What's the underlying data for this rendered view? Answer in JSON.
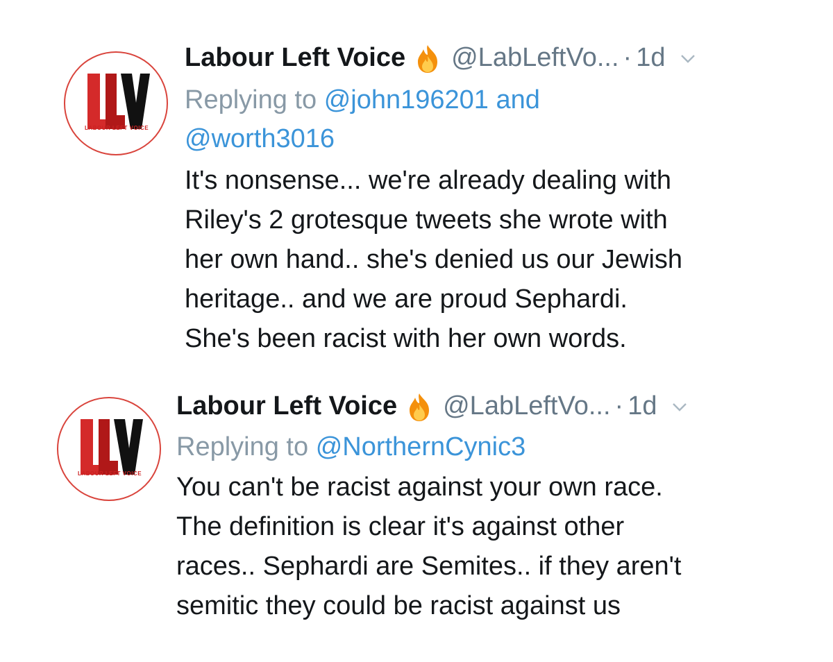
{
  "tweets": [
    {
      "author": "Labour Left Voice",
      "handle": "@LabLeftVo...",
      "separator": "·",
      "time": "1d",
      "reply_prefix": "Replying to",
      "reply_mentions": [
        "@john196201",
        "and",
        "@worth3016"
      ],
      "text": "It's nonsense... we're already dealing with\nRiley's 2 grotesque tweets she wrote with\nher own hand.. she's denied us our Jewish\nheritage.. and we are proud Sephardi.\nShe's been racist with her own words.",
      "avatar_logo_text": "LLV",
      "avatar_caption": "LABOUR LEFT VOICE"
    },
    {
      "author": "Labour Left Voice",
      "handle": "@LabLeftVo...",
      "separator": "·",
      "time": "1d",
      "reply_prefix": "Replying to",
      "reply_mentions": [
        "@NorthernCynic3"
      ],
      "text": "You can't be racist against your own race.\nThe definition is clear it's against other\nraces.. Sephardi are Semites.. if they aren't\nsemitic they could be racist against us",
      "avatar_logo_text": "LLV",
      "avatar_caption": "LABOUR LEFT VOICE"
    }
  ],
  "icons": {
    "emoji_after_name": "fire-icon",
    "menu": "chevron-down-icon"
  },
  "colors": {
    "text": "#14171a",
    "secondary": "#657786",
    "mention": "#3b94d9",
    "logo_red": "#cc2222",
    "avatar_border": "#d9443c"
  }
}
